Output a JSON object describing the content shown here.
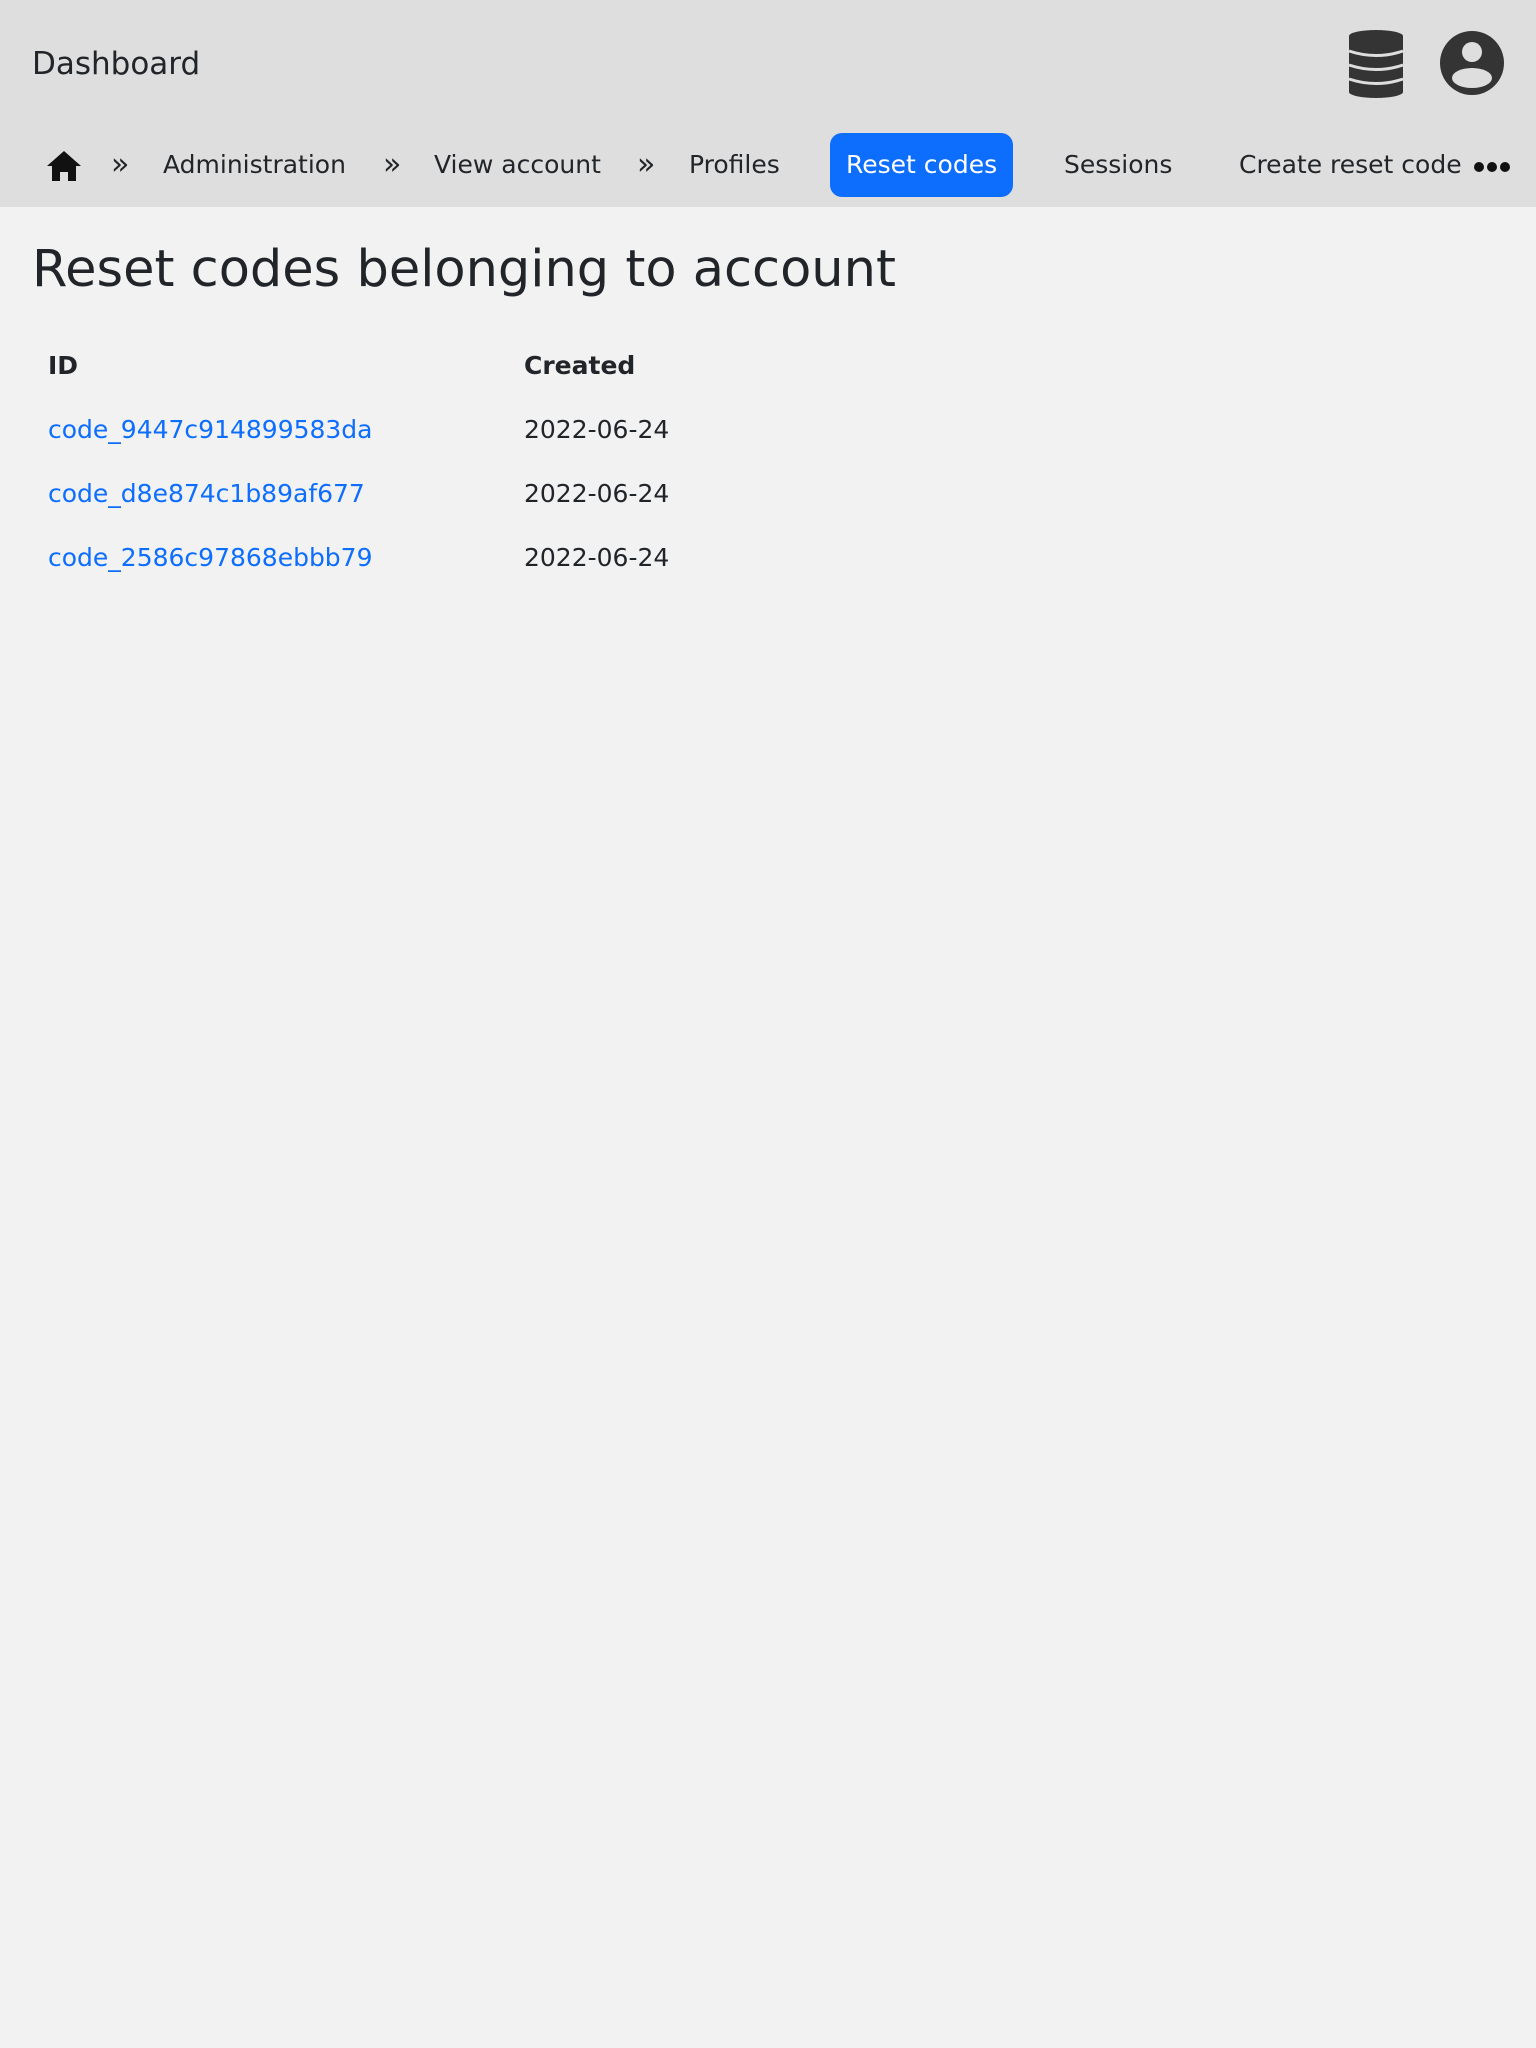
{
  "header": {
    "title": "Dashboard",
    "database_icon": "database-icon",
    "user_icon": "user-circle-icon"
  },
  "nav": {
    "home_icon": "home-icon",
    "separator": "»",
    "breadcrumbs": [
      "Administration",
      "View account",
      "Profiles"
    ],
    "tabs": [
      {
        "label": "Reset codes",
        "active": true
      },
      {
        "label": "Sessions",
        "active": false
      },
      {
        "label": "Create reset code",
        "active": false
      }
    ],
    "more_icon": "more-horizontal-icon",
    "active_color": "#0d6efd"
  },
  "main": {
    "title": "Reset codes belonging to account",
    "table": {
      "columns": [
        "ID",
        "Created"
      ],
      "rows": [
        {
          "id": "code_9447c914899583da",
          "created": "2022-06-24"
        },
        {
          "id": "code_d8e874c1b89af677",
          "created": "2022-06-24"
        },
        {
          "id": "code_2586c97868ebbb79",
          "created": "2022-06-24"
        }
      ]
    },
    "link_color": "#0d6efd"
  }
}
